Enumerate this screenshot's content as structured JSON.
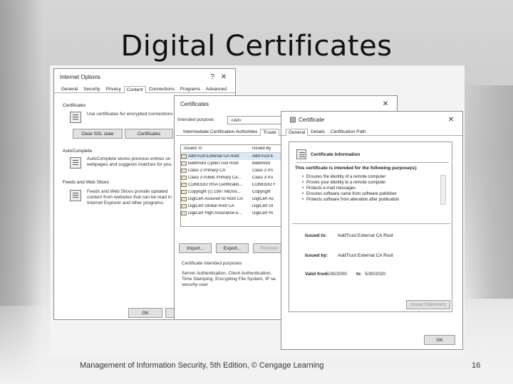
{
  "slide": {
    "title": "Digital Certificates",
    "footer": "Management of Information Security, 5th Edition, © Cengage Learning",
    "page_number": "16"
  },
  "internet_options": {
    "title": "Internet Options",
    "help": "?",
    "close": "✕",
    "tabs": [
      "General",
      "Security",
      "Privacy",
      "Content",
      "Connections",
      "Programs",
      "Advanced"
    ],
    "active_tab": "Content",
    "certificates_group": "Certificates",
    "certificates_text": "Use certificates for encrypted connections and identification.",
    "clear_ssl_button": "Clear SSL state",
    "certificates_button": "Certificates",
    "autocomplete_group": "AutoComplete",
    "autocomplete_text": "AutoComplete stores previous entries on webpages and suggests matches for you.",
    "feeds_group": "Feeds and Web Slices",
    "feeds_text": "Feeds and Web Slices provide updated content from websites that can be read in Internet Explorer and other programs.",
    "ok_button": "OK"
  },
  "certificates_dialog": {
    "title": "Certificates",
    "close": "✕",
    "intended_purpose_label": "Intended purpose:",
    "intended_purpose_value": "<All>",
    "tabs": [
      "Intermediate Certification Authorities",
      "Truste"
    ],
    "columns": [
      "Issued To",
      "Issued By"
    ],
    "rows": [
      {
        "issued_to": "AddTrust External CA Root",
        "issued_by": "AddTrust E"
      },
      {
        "issued_to": "Baltimore CyberTrust Root",
        "issued_by": "Baltimore"
      },
      {
        "issued_to": "Class 2 Primary CA",
        "issued_by": "Class 2 Pri"
      },
      {
        "issued_to": "Class 3 Public Primary Ce...",
        "issued_by": "Class 3 Pu"
      },
      {
        "issued_to": "COMODO RSA Certificatio...",
        "issued_by": "COMODO F"
      },
      {
        "issued_to": "Copyright (c) 1997 Micros...",
        "issued_by": "Copyright"
      },
      {
        "issued_to": "DigiCert Assured ID Root CA",
        "issued_by": "DigiCert As"
      },
      {
        "issued_to": "DigiCert Global Root CA",
        "issued_by": "DigiCert Gl"
      },
      {
        "issued_to": "DigiCert High Assurance E...",
        "issued_by": "DigiCert Hi"
      }
    ],
    "import_button": "Import...",
    "export_button": "Export...",
    "remove_button": "Remove",
    "intended_purposes_label": "Certificate intended purposes",
    "intended_purposes_text": "Server Authentication, Client Authentication, Time Stamping, Encrypting File System, IP se security user"
  },
  "certificate_dialog": {
    "title": "Certificate",
    "close": "✕",
    "tabs": [
      "General",
      "Details",
      "Certification Path"
    ],
    "active_tab": "General",
    "info_heading": "Certificate Information",
    "purpose_heading": "This certificate is intended for the following purpose(s):",
    "purposes": [
      "Ensures the identity of a remote computer",
      "Proves your identity to a remote computer",
      "Protects e-mail messages",
      "Ensures software came from software publisher",
      "Protects software from alteration after publication"
    ],
    "issued_to_label": "Issued to:",
    "issued_to_value": "AddTrust External CA Root",
    "issued_by_label": "Issued by:",
    "issued_by_value": "AddTrust External CA Root",
    "valid_from_label": "Valid from",
    "valid_from_value": "5/30/2000",
    "valid_to_label": "to",
    "valid_to_value": "5/30/2020",
    "issuer_statement_button": "Issuer Statement",
    "ok_button": "OK"
  }
}
